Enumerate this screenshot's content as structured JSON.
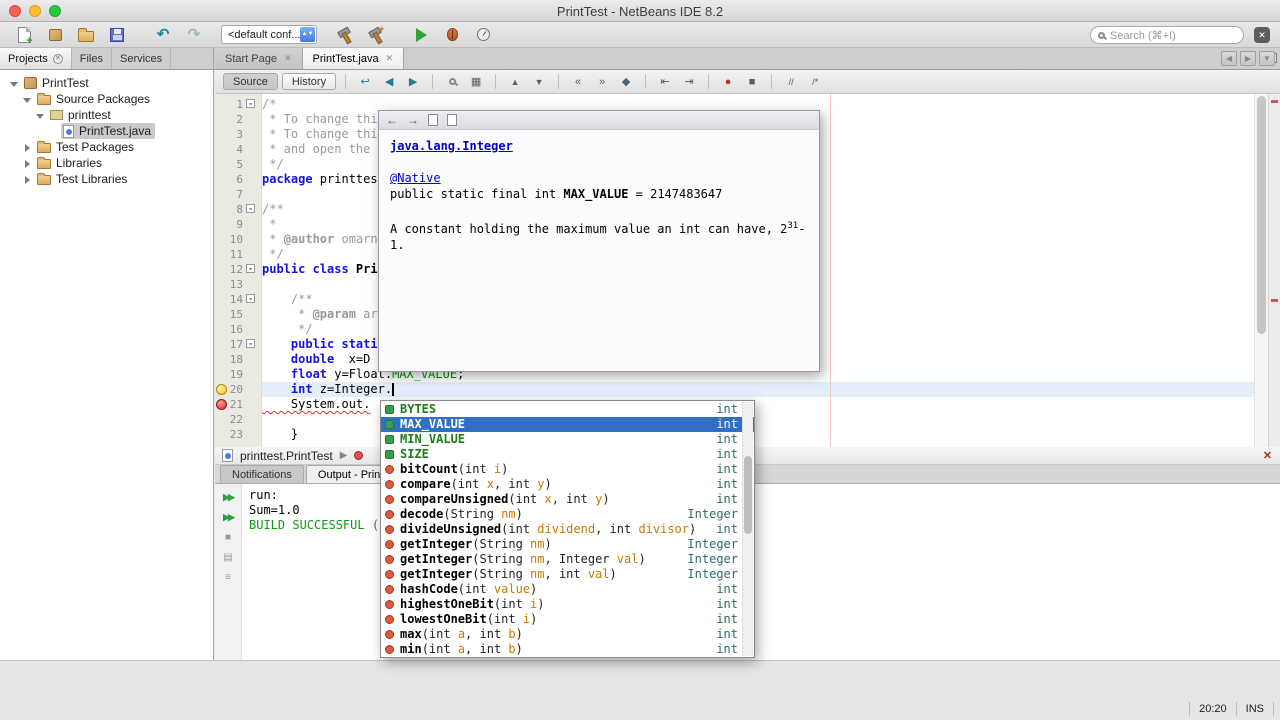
{
  "window": {
    "title": "PrintTest - NetBeans IDE 8.2",
    "status_caret": "20:20",
    "status_mode": "INS"
  },
  "toolbar": {
    "config_value": "<default conf...",
    "search_placeholder": "Search (⌘+I)"
  },
  "panel_tabs": {
    "items": [
      {
        "label": "Projects",
        "active": true,
        "closable": true
      },
      {
        "label": "Files",
        "active": false,
        "closable": false
      },
      {
        "label": "Services",
        "active": false,
        "closable": false
      }
    ]
  },
  "doc_tabs": {
    "items": [
      {
        "label": "Start Page",
        "active": false
      },
      {
        "label": "PrintTest.java",
        "active": true
      }
    ]
  },
  "projects_tree": {
    "items": [
      {
        "label": "PrintTest",
        "level": 0,
        "arrow": "expanded",
        "icon": "project",
        "selected": false
      },
      {
        "label": "Source Packages",
        "level": 1,
        "arrow": "expanded",
        "icon": "folder",
        "selected": false
      },
      {
        "label": "printtest",
        "level": 2,
        "arrow": "expanded",
        "icon": "package",
        "selected": false
      },
      {
        "label": "PrintTest.java",
        "level": 3,
        "arrow": "none",
        "icon": "javafile",
        "selected": true
      },
      {
        "label": "Test Packages",
        "level": 1,
        "arrow": "collapsed",
        "icon": "folder",
        "selected": false
      },
      {
        "label": "Libraries",
        "level": 1,
        "arrow": "collapsed",
        "icon": "folder",
        "selected": false
      },
      {
        "label": "Test Libraries",
        "level": 1,
        "arrow": "collapsed",
        "icon": "folder",
        "selected": false
      }
    ]
  },
  "editor": {
    "source_label": "Source",
    "history_label": "History",
    "lines": [
      {
        "n": 1,
        "fold": true,
        "tokens": [
          {
            "c": "com",
            "s": "/*"
          }
        ]
      },
      {
        "n": 2,
        "tokens": [
          {
            "c": "com",
            "s": " * To change thi"
          }
        ]
      },
      {
        "n": 3,
        "tokens": [
          {
            "c": "com",
            "s": " * To change thi"
          }
        ]
      },
      {
        "n": 4,
        "tokens": [
          {
            "c": "com",
            "s": " * and open the "
          }
        ]
      },
      {
        "n": 5,
        "tokens": [
          {
            "c": "com",
            "s": " */"
          }
        ]
      },
      {
        "n": 6,
        "tokens": [
          {
            "c": "kw",
            "s": "package"
          },
          {
            "c": "plain",
            "s": " printtes"
          }
        ]
      },
      {
        "n": 7,
        "tokens": []
      },
      {
        "n": 8,
        "fold": true,
        "tokens": [
          {
            "c": "com",
            "s": "/**"
          }
        ]
      },
      {
        "n": 9,
        "tokens": [
          {
            "c": "com",
            "s": " *"
          }
        ]
      },
      {
        "n": 10,
        "tokens": [
          {
            "c": "com",
            "s": " * "
          },
          {
            "c": "comtag",
            "s": "@author"
          },
          {
            "c": "com",
            "s": " omarn"
          }
        ]
      },
      {
        "n": 11,
        "tokens": [
          {
            "c": "com",
            "s": " */"
          }
        ]
      },
      {
        "n": 12,
        "fold": true,
        "tokens": [
          {
            "c": "kw",
            "s": "public class "
          },
          {
            "c": "cls",
            "s": "Pri"
          }
        ]
      },
      {
        "n": 13,
        "tokens": []
      },
      {
        "n": 14,
        "fold": true,
        "tokens": [
          {
            "c": "com",
            "s": "    /**"
          }
        ]
      },
      {
        "n": 15,
        "tokens": [
          {
            "c": "com",
            "s": "     * "
          },
          {
            "c": "comtag",
            "s": "@param"
          },
          {
            "c": "com",
            "s": " ar"
          }
        ]
      },
      {
        "n": 16,
        "tokens": [
          {
            "c": "com",
            "s": "     */"
          }
        ]
      },
      {
        "n": 17,
        "fold": true,
        "tokens": [
          {
            "c": "kw",
            "s": "    public stati"
          }
        ]
      },
      {
        "n": 18,
        "tokens": [
          {
            "c": "kw",
            "s": "    double"
          },
          {
            "c": "plain",
            "s": "  x=D"
          }
        ]
      },
      {
        "n": 19,
        "tokens": [
          {
            "c": "kw",
            "s": "    float"
          },
          {
            "c": "plain",
            "s": " y=Float."
          },
          {
            "c": "field",
            "s": "MAX_VALUE"
          },
          {
            "c": "plain",
            "s": "; "
          }
        ]
      },
      {
        "n": 20,
        "current": true,
        "glyph": "hint",
        "tokens": [
          {
            "c": "kw",
            "s": "    int"
          },
          {
            "c": "plain",
            "s": " z=Integer."
          }
        ]
      },
      {
        "n": 21,
        "glyph": "error",
        "tokens": [
          {
            "c": "err",
            "s": "    System.out."
          }
        ]
      },
      {
        "n": 22,
        "tokens": []
      },
      {
        "n": 23,
        "tokens": [
          {
            "c": "plain",
            "s": "    }"
          }
        ]
      }
    ]
  },
  "doc_popup": {
    "link": "java.lang.Integer",
    "annotation": "@Native",
    "sig_pre": "public static final int ",
    "sig_name": "MAX_VALUE",
    "sig_post": " = 2147483647",
    "desc_1": "A constant holding the maximum value an ",
    "desc_code": "int",
    "desc_2": " can have, 2",
    "desc_sup": "31",
    "desc_3": "-1."
  },
  "completion": {
    "items": [
      {
        "kind": "field",
        "selected": false,
        "type": "int",
        "parts": [
          {
            "c": "fname",
            "s": "BYTES"
          }
        ]
      },
      {
        "kind": "field",
        "selected": true,
        "type": "int",
        "parts": [
          {
            "c": "fname",
            "s": "MAX_VALUE"
          }
        ]
      },
      {
        "kind": "field",
        "selected": false,
        "type": "int",
        "parts": [
          {
            "c": "fname",
            "s": "MIN_VALUE"
          }
        ]
      },
      {
        "kind": "field",
        "selected": false,
        "type": "int",
        "parts": [
          {
            "c": "fname",
            "s": "SIZE"
          }
        ]
      },
      {
        "kind": "method",
        "selected": false,
        "type": "int",
        "parts": [
          {
            "c": "mname",
            "s": "bitCount"
          },
          {
            "c": "p",
            "s": "(int "
          },
          {
            "c": "pv",
            "s": "i"
          },
          {
            "c": "p",
            "s": ")"
          }
        ]
      },
      {
        "kind": "method",
        "selected": false,
        "type": "int",
        "parts": [
          {
            "c": "mname",
            "s": "compare"
          },
          {
            "c": "p",
            "s": "(int "
          },
          {
            "c": "pv",
            "s": "x"
          },
          {
            "c": "p",
            "s": ", int "
          },
          {
            "c": "pv",
            "s": "y"
          },
          {
            "c": "p",
            "s": ")"
          }
        ]
      },
      {
        "kind": "method",
        "selected": false,
        "type": "int",
        "parts": [
          {
            "c": "mname",
            "s": "compareUnsigned"
          },
          {
            "c": "p",
            "s": "(int "
          },
          {
            "c": "pv",
            "s": "x"
          },
          {
            "c": "p",
            "s": ", int "
          },
          {
            "c": "pv",
            "s": "y"
          },
          {
            "c": "p",
            "s": ")"
          }
        ]
      },
      {
        "kind": "method",
        "selected": false,
        "type": "Integer",
        "parts": [
          {
            "c": "mname",
            "s": "decode"
          },
          {
            "c": "p",
            "s": "(String "
          },
          {
            "c": "pv",
            "s": "nm"
          },
          {
            "c": "p",
            "s": ")"
          }
        ]
      },
      {
        "kind": "method",
        "selected": false,
        "type": "int",
        "parts": [
          {
            "c": "mname",
            "s": "divideUnsigned"
          },
          {
            "c": "p",
            "s": "(int "
          },
          {
            "c": "pv",
            "s": "dividend"
          },
          {
            "c": "p",
            "s": ", int "
          },
          {
            "c": "pv",
            "s": "divisor"
          },
          {
            "c": "p",
            "s": ")"
          }
        ]
      },
      {
        "kind": "method",
        "selected": false,
        "type": "Integer",
        "parts": [
          {
            "c": "mname",
            "s": "getInteger"
          },
          {
            "c": "p",
            "s": "(String "
          },
          {
            "c": "pv",
            "s": "nm"
          },
          {
            "c": "p",
            "s": ")"
          }
        ]
      },
      {
        "kind": "method",
        "selected": false,
        "type": "Integer",
        "parts": [
          {
            "c": "mname",
            "s": "getInteger"
          },
          {
            "c": "p",
            "s": "(String "
          },
          {
            "c": "pv",
            "s": "nm"
          },
          {
            "c": "p",
            "s": ", Integer "
          },
          {
            "c": "pv",
            "s": "val"
          },
          {
            "c": "p",
            "s": ")"
          }
        ]
      },
      {
        "kind": "method",
        "selected": false,
        "type": "Integer",
        "parts": [
          {
            "c": "mname",
            "s": "getInteger"
          },
          {
            "c": "p",
            "s": "(String "
          },
          {
            "c": "pv",
            "s": "nm"
          },
          {
            "c": "p",
            "s": ", int "
          },
          {
            "c": "pv",
            "s": "val"
          },
          {
            "c": "p",
            "s": ")"
          }
        ]
      },
      {
        "kind": "method",
        "selected": false,
        "type": "int",
        "parts": [
          {
            "c": "mname",
            "s": "hashCode"
          },
          {
            "c": "p",
            "s": "(int "
          },
          {
            "c": "pv",
            "s": "value"
          },
          {
            "c": "p",
            "s": ")"
          }
        ]
      },
      {
        "kind": "method",
        "selected": false,
        "type": "int",
        "parts": [
          {
            "c": "mname",
            "s": "highestOneBit"
          },
          {
            "c": "p",
            "s": "(int "
          },
          {
            "c": "pv",
            "s": "i"
          },
          {
            "c": "p",
            "s": ")"
          }
        ]
      },
      {
        "kind": "method",
        "selected": false,
        "type": "int",
        "parts": [
          {
            "c": "mname",
            "s": "lowestOneBit"
          },
          {
            "c": "p",
            "s": "(int "
          },
          {
            "c": "pv",
            "s": "i"
          },
          {
            "c": "p",
            "s": ")"
          }
        ]
      },
      {
        "kind": "method",
        "selected": false,
        "type": "int",
        "parts": [
          {
            "c": "mname",
            "s": "max"
          },
          {
            "c": "p",
            "s": "(int "
          },
          {
            "c": "pv",
            "s": "a"
          },
          {
            "c": "p",
            "s": ", int "
          },
          {
            "c": "pv",
            "s": "b"
          },
          {
            "c": "p",
            "s": ")"
          }
        ]
      },
      {
        "kind": "method",
        "selected": false,
        "type": "int",
        "parts": [
          {
            "c": "mname",
            "s": "min"
          },
          {
            "c": "p",
            "s": "(int "
          },
          {
            "c": "pv",
            "s": "a"
          },
          {
            "c": "p",
            "s": ", int "
          },
          {
            "c": "pv",
            "s": "b"
          },
          {
            "c": "p",
            "s": ")"
          }
        ]
      }
    ]
  },
  "bottom": {
    "breadcrumb": "printtest.PrintTest",
    "tabs": {
      "items": [
        {
          "label": "Notifications",
          "active": false
        },
        {
          "label": "Output - PrintTe",
          "active": true
        }
      ]
    },
    "output_lines": [
      {
        "c": "plain",
        "s": "run:"
      },
      {
        "c": "plain",
        "s": "Sum=1.0"
      },
      {
        "c": "green",
        "s": "BUILD SUCCESSFUL ("
      }
    ]
  }
}
